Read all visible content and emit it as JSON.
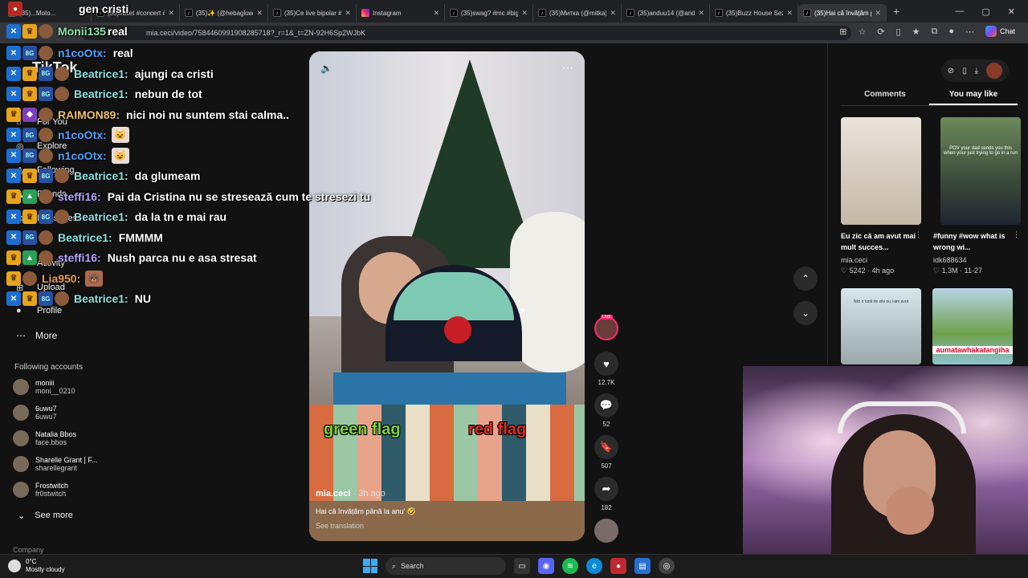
{
  "browser": {
    "tabs": [
      {
        "title": "(35)...Moto...",
        "icon": "tiktok-icon"
      },
      {
        "title": "(35)#bilet #concert #",
        "icon": "tiktok-icon"
      },
      {
        "title": "(35)✨ (@hebaglow)",
        "icon": "tiktok-icon"
      },
      {
        "title": "(35)Ce live bipolar #",
        "icon": "tiktok-icon"
      },
      {
        "title": "Instagram",
        "icon": "instagram-icon"
      },
      {
        "title": "(35)swag? #mc #big",
        "icon": "tiktok-icon"
      },
      {
        "title": "(35)Митка (@mitka)",
        "icon": "tiktok-icon"
      },
      {
        "title": "(35)anduu14 (@andi",
        "icon": "tiktok-icon"
      },
      {
        "title": "(35)Buzz House Sezo",
        "icon": "tiktok-icon"
      },
      {
        "title": "(35)Hai că învățăm p",
        "icon": "tiktok-icon",
        "active": true
      }
    ],
    "url": "mia.ceci/video/7584460991908285718?_r=1&_t=ZN-92H6Sp2WJbK",
    "chat_label": "Chat"
  },
  "stream_overlay": {
    "top_user": "Monii135",
    "top_msg": "real",
    "header_user_msg": "gen cristi",
    "messages": [
      {
        "user": "n1coOtx:",
        "color": "#4fa3ff",
        "text": "real",
        "emote": ""
      },
      {
        "user": "Beatrice1:",
        "color": "#8ee3e3",
        "text": "ajungi ca cristi",
        "emote": ""
      },
      {
        "user": "Beatrice1:",
        "color": "#8ee3e3",
        "text": "nebun de tot",
        "emote": ""
      },
      {
        "user": "RAIMON89:",
        "color": "#e9c26a",
        "text": "nici noi nu suntem stai calma..",
        "emote": ""
      },
      {
        "user": "n1coOtx:",
        "color": "#4fa3ff",
        "text": "",
        "emote": "😺"
      },
      {
        "user": "n1coOtx:",
        "color": "#4fa3ff",
        "text": "",
        "emote": "😺"
      },
      {
        "user": "Beatrice1:",
        "color": "#8ee3e3",
        "text": "da glumeam",
        "emote": ""
      },
      {
        "user": "steffi16:",
        "color": "#b7a6ff",
        "text": "Pai da Cristina nu se stresează cum te stresezi tu",
        "emote": ""
      },
      {
        "user": "Beatrice1:",
        "color": "#8ee3e3",
        "text": "da la tn e mai rau",
        "emote": ""
      },
      {
        "user": "Beatrice1:",
        "color": "#8ee3e3",
        "text": "FMMMM",
        "emote": ""
      },
      {
        "user": "steffi16:",
        "color": "#b7a6ff",
        "text": "Nush parca nu e asa stresat",
        "emote": ""
      },
      {
        "user": "Lia950:",
        "color": "#f1a04a",
        "text": "",
        "emote": "🐻"
      },
      {
        "user": "Beatrice1:",
        "color": "#8ee3e3",
        "text": "NU",
        "emote": ""
      }
    ]
  },
  "sidebar": {
    "brand": "TikTok",
    "nav": [
      {
        "label": "For You",
        "icon": "home-icon"
      },
      {
        "label": "Explore",
        "icon": "compass-icon"
      },
      {
        "label": "Following",
        "icon": "following-icon"
      },
      {
        "label": "Friends",
        "icon": "friends-icon"
      },
      {
        "label": "Messages",
        "icon": "message-icon"
      },
      {
        "label": "Activity",
        "icon": "bell-icon"
      },
      {
        "label": "Upload",
        "icon": "upload-icon"
      },
      {
        "label": "Profile",
        "icon": "profile-icon"
      }
    ],
    "more_label": "More",
    "following_header": "Following accounts",
    "accounts": [
      {
        "name": "moniii",
        "handle": "moni__0210"
      },
      {
        "name": "6uwu7",
        "handle": "6uwu7"
      },
      {
        "name": "Natalia Bbos",
        "handle": "face.bbos"
      },
      {
        "name": "Sharelle Grant | F...",
        "handle": "sharellegrant"
      },
      {
        "name": "Frostwitch",
        "handle": "fr0stwitch"
      }
    ],
    "see_more": "See more",
    "company": "Company"
  },
  "video": {
    "author": "mia.ceci",
    "time": "· 3h ago",
    "caption": "Hai că învățăm până la anu' 🤣",
    "translate": "See translation",
    "overlay_left": "green flag",
    "overlay_right": "red flag",
    "likes": "12.7K",
    "comments": "52",
    "saves": "507",
    "shares": "182",
    "live_tag": "LIVE"
  },
  "right_panel": {
    "tabs": [
      "Comments",
      "You may like"
    ],
    "cards": [
      {
        "title": "Eu zic că am avut mai mult succes...",
        "author": "mia.ceci",
        "likes": "5242",
        "time": "· 4h ago"
      },
      {
        "title": "#funny #wow what is wrong wi...",
        "author": "idk688634",
        "likes": "1.3M",
        "time": "· 11-27"
      }
    ],
    "card2_overlay": "POV your dad sends you this when your just trying to go in a run",
    "card3_overlay": "Nici o lună de zile nu i-am avut",
    "card4_overlay": "aumatawhakatangiha"
  },
  "taskbar": {
    "temp": "0°C",
    "weather": "Mostly cloudy",
    "search": "Search"
  }
}
